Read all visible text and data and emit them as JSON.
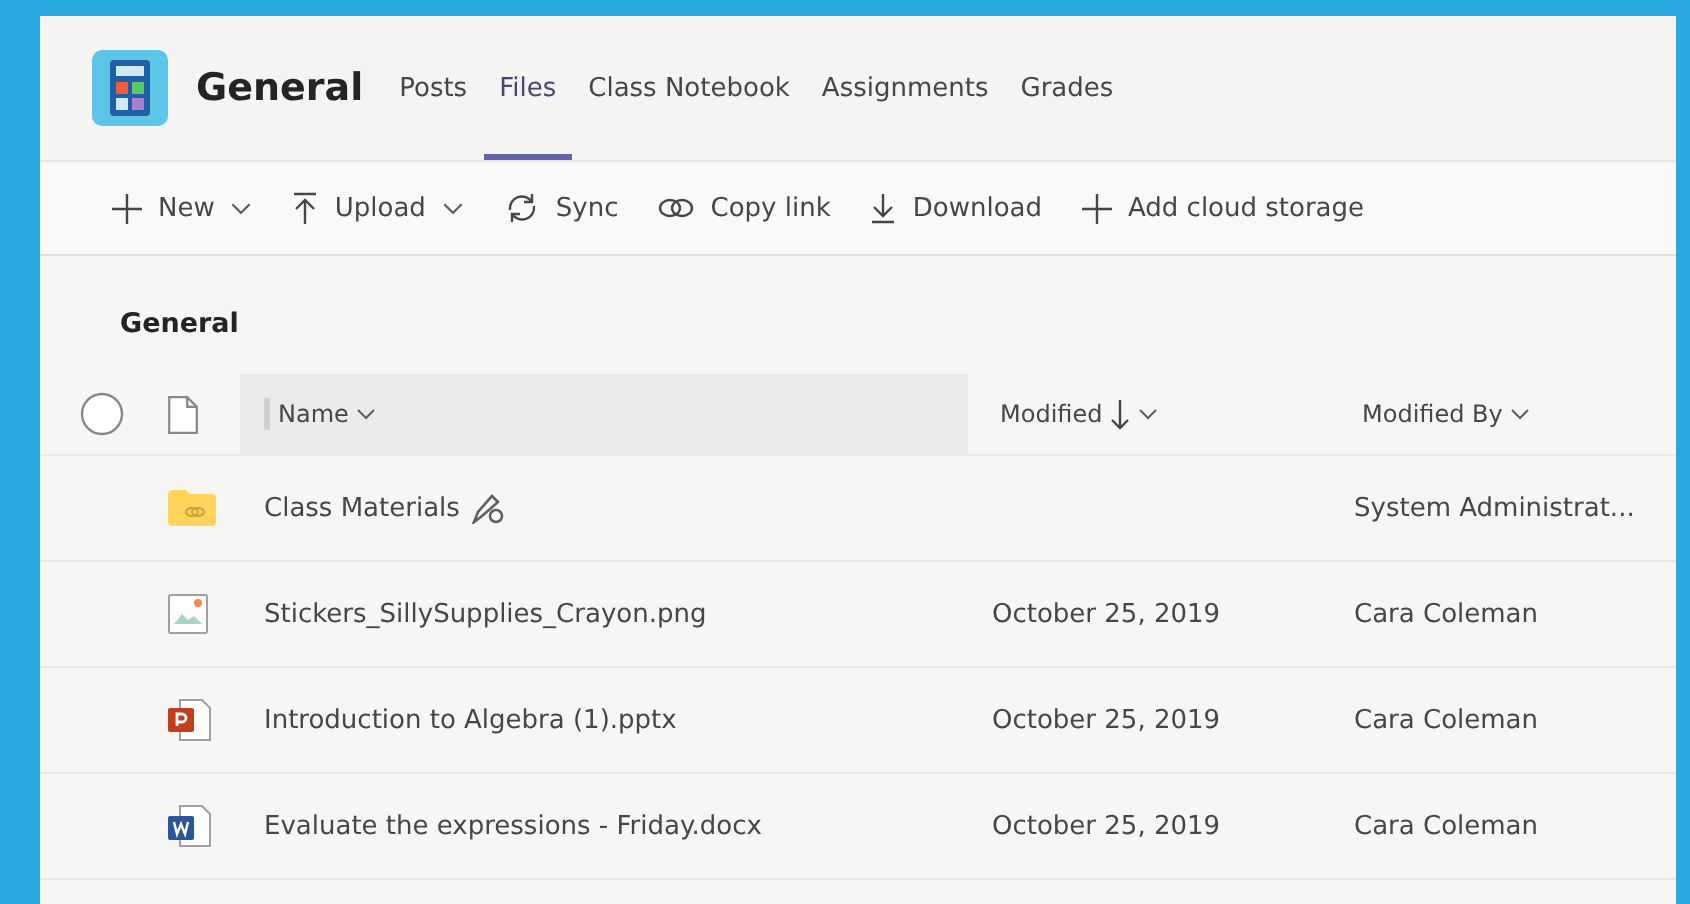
{
  "header": {
    "title": "General",
    "tabs": [
      {
        "label": "Posts",
        "selected": false
      },
      {
        "label": "Files",
        "selected": true
      },
      {
        "label": "Class Notebook",
        "selected": false
      },
      {
        "label": "Assignments",
        "selected": false
      },
      {
        "label": "Grades",
        "selected": false
      }
    ]
  },
  "toolbar": [
    {
      "kind": "plus",
      "label": "New",
      "dropdown": true
    },
    {
      "kind": "upload",
      "label": "Upload",
      "dropdown": true
    },
    {
      "kind": "sync",
      "label": "Sync",
      "dropdown": false
    },
    {
      "kind": "link",
      "label": "Copy link",
      "dropdown": false
    },
    {
      "kind": "download",
      "label": "Download",
      "dropdown": false
    },
    {
      "kind": "plus",
      "label": "Add cloud storage",
      "dropdown": false
    }
  ],
  "breadcrumb": "General",
  "table": {
    "columns": [
      {
        "label": "Name",
        "sorted": false,
        "hovered": true
      },
      {
        "label": "Modified",
        "sorted": true,
        "hovered": false
      },
      {
        "label": "Modified By",
        "sorted": false,
        "hovered": false
      }
    ],
    "rows": [
      {
        "kind": "folder",
        "name": "Class Materials",
        "edit_mark": true,
        "modified": "",
        "modified_by": "System Administrat..."
      },
      {
        "kind": "image",
        "name": "Stickers_SillySupplies_Crayon.png",
        "edit_mark": false,
        "modified": "October 25, 2019",
        "modified_by": "Cara Coleman"
      },
      {
        "kind": "powerpoint",
        "name": "Introduction to Algebra (1).pptx",
        "edit_mark": false,
        "modified": "October 25, 2019",
        "modified_by": "Cara Coleman"
      },
      {
        "kind": "word",
        "name": "Evaluate the expressions - Friday.docx",
        "edit_mark": false,
        "modified": "October 25, 2019",
        "modified_by": "Cara Coleman"
      }
    ]
  }
}
